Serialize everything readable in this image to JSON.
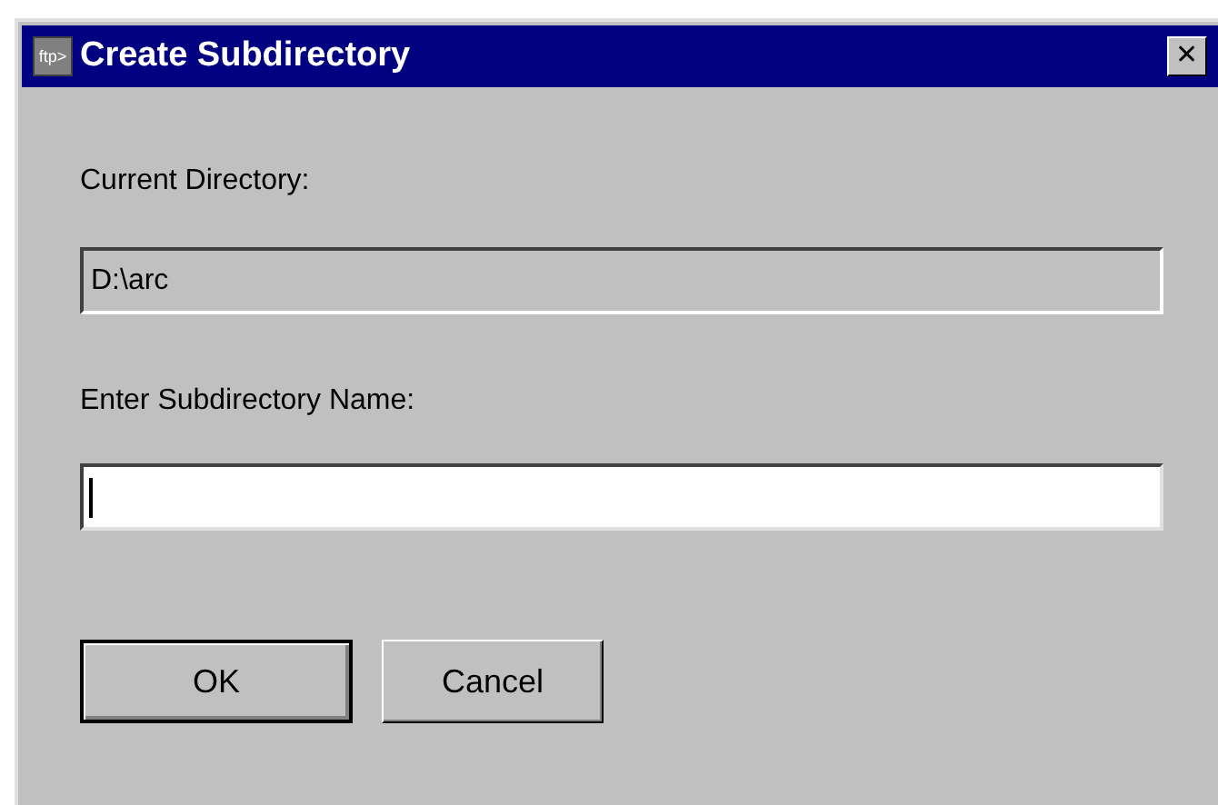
{
  "window": {
    "title": "Create Subdirectory",
    "icon_text": "ftp>",
    "close": "✕"
  },
  "current_directory": {
    "label": "Current Directory:",
    "value": "D:\\arc"
  },
  "subdirectory": {
    "label": "Enter Subdirectory Name:",
    "focused": true
  },
  "buttons": [
    {
      "label": "OK",
      "default": true
    },
    {
      "label": "Cancel",
      "default": false
    }
  ]
}
